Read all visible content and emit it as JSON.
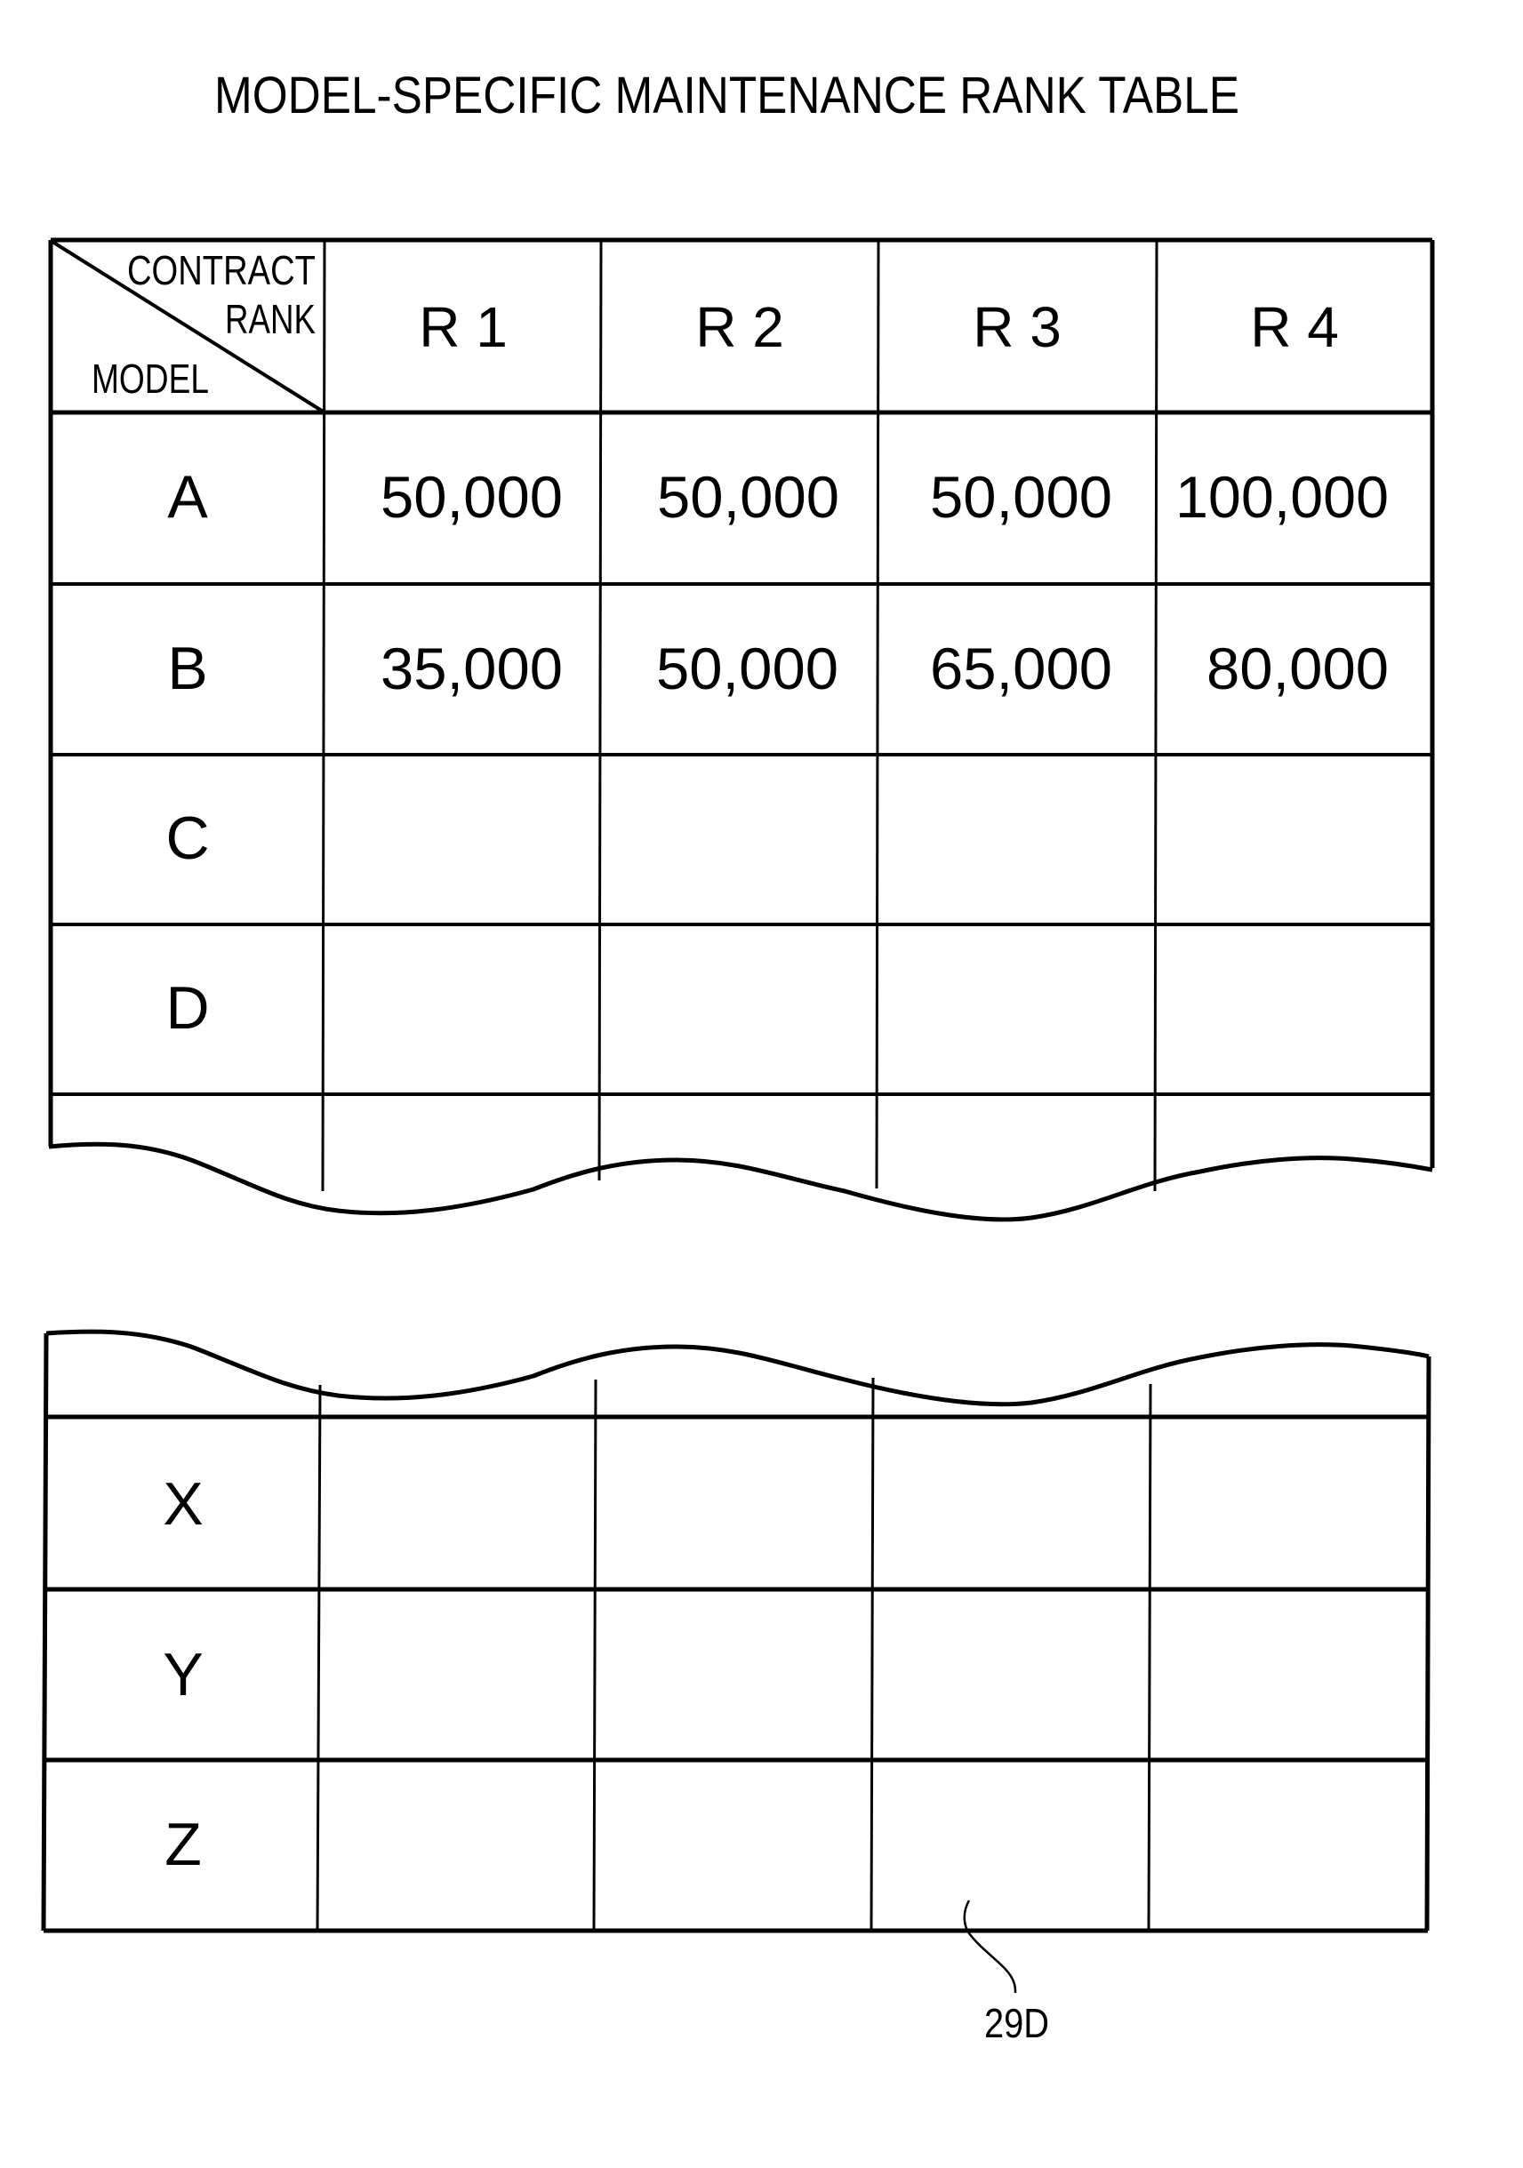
{
  "document": {
    "title": "MODEL-SPECIFIC MAINTENANCE RANK TABLE",
    "reference_label": "29D"
  },
  "table": {
    "corner_header": {
      "column_axis_label_line1": "CONTRACT",
      "column_axis_label_line2": "RANK",
      "row_axis_label": "MODEL"
    },
    "columns": [
      "R 1",
      "R 2",
      "R 3",
      "R 4"
    ],
    "top_rows": [
      {
        "model": "A",
        "values": [
          "50,000",
          "50,000",
          "50,000",
          "100,000"
        ]
      },
      {
        "model": "B",
        "values": [
          "35,000",
          "50,000",
          "65,000",
          "80,000"
        ]
      },
      {
        "model": "C",
        "values": [
          "",
          "",
          "",
          ""
        ]
      },
      {
        "model": "D",
        "values": [
          "",
          "",
          "",
          ""
        ]
      }
    ],
    "bottom_rows": [
      {
        "model": "X",
        "values": [
          "",
          "",
          "",
          ""
        ]
      },
      {
        "model": "Y",
        "values": [
          "",
          "",
          "",
          ""
        ]
      },
      {
        "model": "Z",
        "values": [
          "",
          "",
          "",
          ""
        ]
      }
    ]
  }
}
